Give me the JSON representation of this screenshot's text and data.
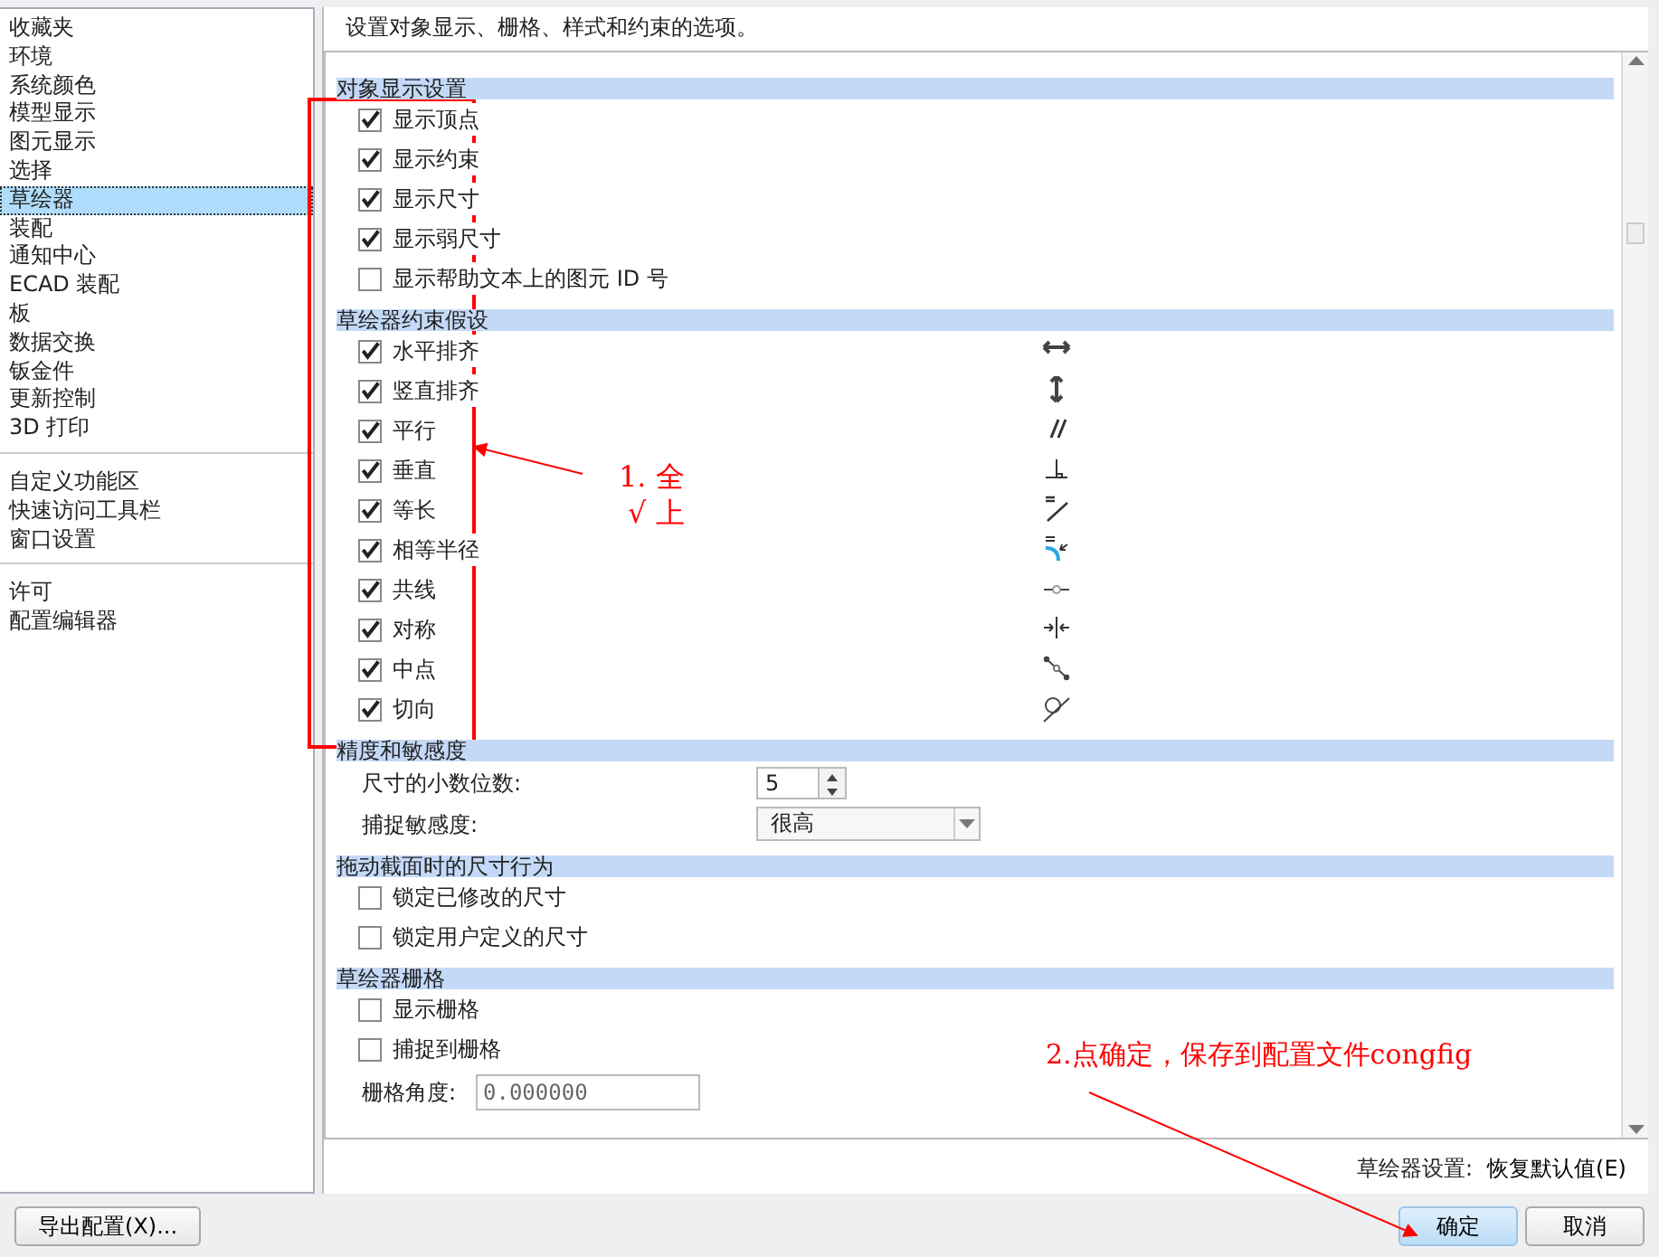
{
  "sidebar": {
    "groups": [
      [
        {
          "label": "收藏夹",
          "selected": false
        },
        {
          "label": "环境",
          "selected": false
        },
        {
          "label": "系统颜色",
          "selected": false
        },
        {
          "label": "模型显示",
          "selected": false
        },
        {
          "label": "图元显示",
          "selected": false
        },
        {
          "label": "选择",
          "selected": false
        },
        {
          "label": "草绘器",
          "selected": true
        },
        {
          "label": "装配",
          "selected": false
        },
        {
          "label": "通知中心",
          "selected": false
        },
        {
          "label": "ECAD 装配",
          "selected": false
        },
        {
          "label": "板",
          "selected": false
        },
        {
          "label": "数据交换",
          "selected": false
        },
        {
          "label": "钣金件",
          "selected": false
        },
        {
          "label": "更新控制",
          "selected": false
        },
        {
          "label": "3D 打印",
          "selected": false
        }
      ],
      [
        {
          "label": "自定义功能区",
          "selected": false
        },
        {
          "label": "快速访问工具栏",
          "selected": false
        },
        {
          "label": "窗口设置",
          "selected": false
        }
      ],
      [
        {
          "label": "许可",
          "selected": false
        },
        {
          "label": "配置编辑器",
          "selected": false
        }
      ]
    ]
  },
  "description": "设置对象显示、栅格、样式和约束的选项。",
  "sections": [
    {
      "title": "对象显示设置",
      "items": [
        {
          "kind": "checkbox",
          "label": "显示顶点",
          "checked": true
        },
        {
          "kind": "checkbox",
          "label": "显示约束",
          "checked": true
        },
        {
          "kind": "checkbox",
          "label": "显示尺寸",
          "checked": true
        },
        {
          "kind": "checkbox",
          "label": "显示弱尺寸",
          "checked": true
        },
        {
          "kind": "checkbox",
          "label": "显示帮助文本上的图元 ID 号",
          "checked": false
        }
      ]
    },
    {
      "title": "草绘器约束假设",
      "items": [
        {
          "kind": "constraint",
          "label": "水平排齐",
          "checked": true
        },
        {
          "kind": "constraint",
          "label": "竖直排齐",
          "checked": true
        },
        {
          "kind": "constraint",
          "label": "平行",
          "checked": true
        },
        {
          "kind": "constraint",
          "label": "垂直",
          "checked": true
        },
        {
          "kind": "constraint",
          "label": "等长",
          "checked": true
        },
        {
          "kind": "constraint",
          "label": "相等半径",
          "checked": true
        },
        {
          "kind": "constraint",
          "label": "共线",
          "checked": true
        },
        {
          "kind": "constraint",
          "label": "对称",
          "checked": true
        },
        {
          "kind": "constraint",
          "label": "中点",
          "checked": true
        },
        {
          "kind": "constraint",
          "label": "切向",
          "checked": true
        }
      ]
    },
    {
      "title": "精度和敏感度",
      "items": [
        {
          "kind": "spinner",
          "label": "尺寸的小数位数:",
          "value": "5"
        },
        {
          "kind": "dropdown",
          "label": "捕捉敏感度:",
          "value": "很高"
        }
      ]
    },
    {
      "title": "拖动截面时的尺寸行为",
      "items": [
        {
          "kind": "checkbox",
          "label": "锁定已修改的尺寸",
          "checked": false
        },
        {
          "kind": "checkbox",
          "label": "锁定用户定义的尺寸",
          "checked": false
        }
      ]
    },
    {
      "title": "草绘器栅格",
      "items": [
        {
          "kind": "checkbox",
          "label": "显示栅格",
          "checked": false
        },
        {
          "kind": "checkbox",
          "label": "捕捉到栅格",
          "checked": false
        },
        {
          "kind": "textfield",
          "label": "栅格角度:",
          "value": "0.000000"
        }
      ]
    }
  ],
  "settings_label": "草绘器设置:",
  "restore_button": "恢复默认值(E)",
  "export_button": "导出配置(X)...",
  "ok_button": "确定",
  "cancel_button": "取消",
  "annotations": {
    "note_1": [
      "1. 全",
      "√ 上"
    ],
    "note_2": "2.点确定，保存到配置文件congfig"
  }
}
